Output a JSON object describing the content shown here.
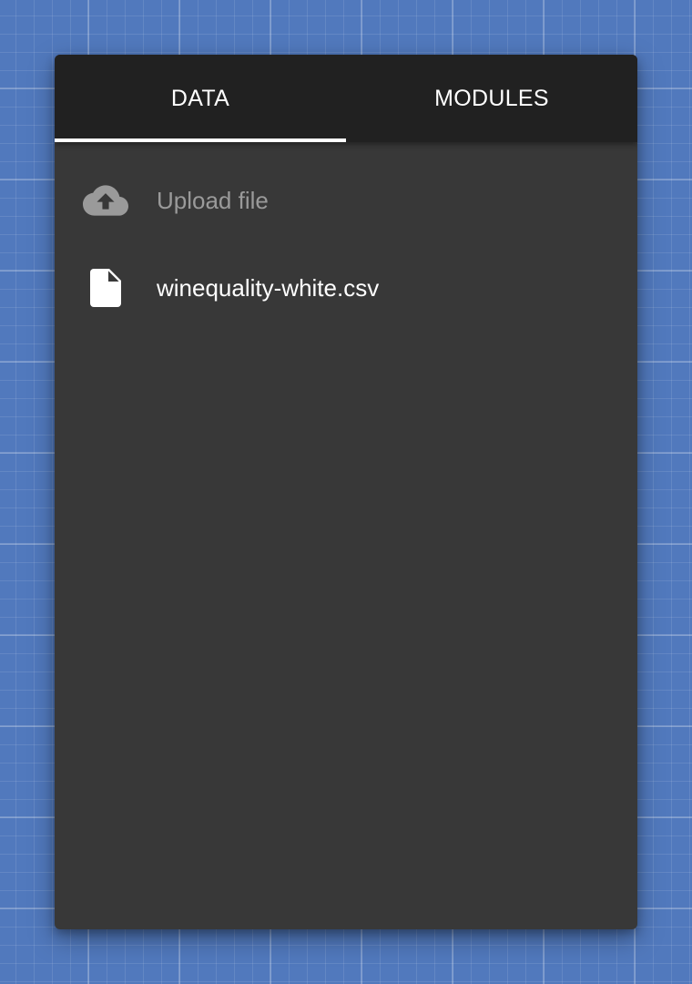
{
  "tabs": [
    {
      "label": "DATA",
      "active": true
    },
    {
      "label": "MODULES",
      "active": false
    }
  ],
  "list": {
    "upload": {
      "label": "Upload file",
      "icon": "cloud-upload-icon"
    },
    "files": [
      {
        "label": "winequality-white.csv",
        "icon": "file-icon"
      }
    ]
  },
  "colors": {
    "background": "#5179bd",
    "panel": "#383838",
    "tabbar": "#212121",
    "indicator": "#ffffff",
    "muted_text": "#9a9a9a"
  }
}
